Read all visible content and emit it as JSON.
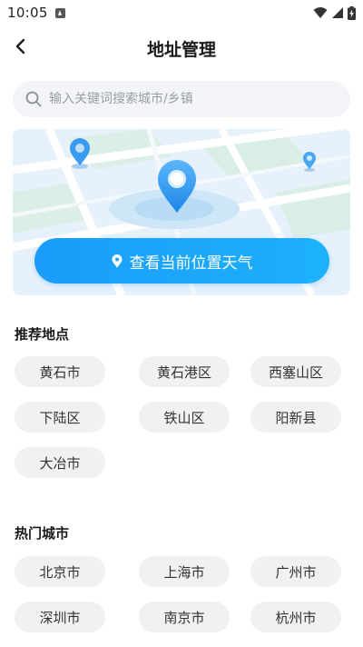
{
  "status": {
    "time": "10:05"
  },
  "header": {
    "title": "地址管理"
  },
  "search": {
    "placeholder": "输入关键词搜索城市/乡镇"
  },
  "map": {
    "locate_label": "查看当前位置天气"
  },
  "recommended": {
    "title": "推荐地点",
    "items": [
      "黄石市",
      "黄石港区",
      "西塞山区",
      "下陆区",
      "铁山区",
      "阳新县",
      "大冶市"
    ]
  },
  "hot": {
    "title": "热门城市",
    "items": [
      "北京市",
      "上海市",
      "广州市",
      "深圳市",
      "南京市",
      "杭州市"
    ]
  },
  "colors": {
    "accent": "#1a9cf8",
    "chip_bg": "#f0f1f3",
    "search_bg": "#f2f4f7"
  }
}
